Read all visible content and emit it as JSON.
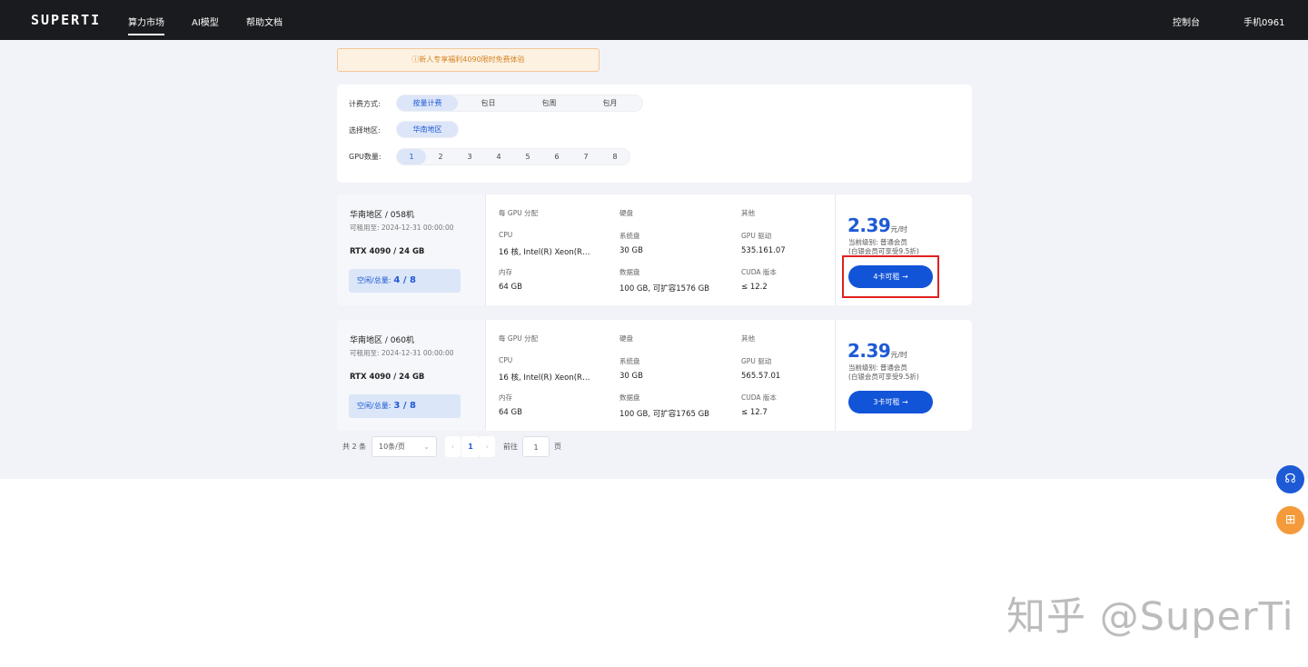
{
  "header": {
    "logo": "SUPERTI",
    "nav": [
      "算力市场",
      "AI模型",
      "帮助文档"
    ],
    "console": "控制台",
    "user": "手机0961"
  },
  "notice": "ⓘ新人专享福利4090限时免费体验",
  "filters": {
    "billing_label": "计费方式:",
    "billing_options": [
      "按量计费",
      "包日",
      "包周",
      "包月"
    ],
    "region_label": "选择地区:",
    "region_options": [
      "华南地区"
    ],
    "gpu_count_label": "GPU数量:",
    "gpu_count_options": [
      "1",
      "2",
      "3",
      "4",
      "5",
      "6",
      "7",
      "8"
    ]
  },
  "labels": {
    "per_gpu": "每 GPU 分配",
    "disk": "硬盘",
    "other": "其他",
    "cpu": "CPU",
    "system_disk": "系统盘",
    "gpu_driver": "GPU 驱动",
    "memory": "内存",
    "data_disk": "数据盘",
    "cuda": "CUDA 版本",
    "free_total": "空闲/总量:",
    "current_level": "当前级别: 普通会员",
    "silver_discount": "(白银会员可享受9.5折)"
  },
  "machines": [
    {
      "title": "华南地区 / 058机",
      "rentable_until": "可租用至: 2024-12-31 00:00:00",
      "gpu": "RTX 4090 / 24 GB",
      "free_total": "4 / 8",
      "cpu": "16 核, Intel(R) Xeon(R…",
      "memory": "64 GB",
      "system_disk": "30 GB",
      "data_disk": "100 GB, 可扩容1576 GB",
      "gpu_driver": "535.161.07",
      "cuda": "≤ 12.2",
      "price": "2.39",
      "price_unit": "元/时",
      "button": "4卡可租 →"
    },
    {
      "title": "华南地区 / 060机",
      "rentable_until": "可租用至: 2024-12-31 00:00:00",
      "gpu": "RTX 4090 / 24 GB",
      "free_total": "3 / 8",
      "cpu": "16 核, Intel(R) Xeon(R…",
      "memory": "64 GB",
      "system_disk": "30 GB",
      "data_disk": "100 GB, 可扩容1765 GB",
      "gpu_driver": "565.57.01",
      "cuda": "≤ 12.7",
      "price": "2.39",
      "price_unit": "元/时",
      "button": "3卡可租 →"
    }
  ],
  "pagination": {
    "total": "共 2 条",
    "page_size": "10条/页",
    "current_page": "1",
    "goto_label": "前往",
    "goto_value": "1",
    "page_suffix": "页"
  },
  "watermark": "知乎 @SuperTi"
}
